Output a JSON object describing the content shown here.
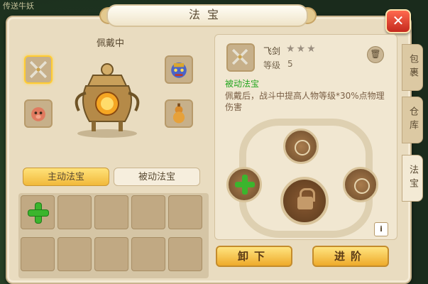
{
  "background": {
    "corner_text": "传送牛妖"
  },
  "window": {
    "title": "法宝",
    "close_label": "✕"
  },
  "left": {
    "wearing_label": "佩戴中",
    "tabs": [
      {
        "label": "主动法宝",
        "active": true
      },
      {
        "label": "被动法宝",
        "active": false
      }
    ],
    "grid": {
      "rows": 3,
      "cols": 5,
      "add_cell_index": 0
    }
  },
  "detail": {
    "name": "飞剑",
    "stars": "★★★",
    "level_label": "等级",
    "level_value": "5",
    "type_tag": "被动法宝",
    "description": "佩戴后，战斗中提高人物等级*30%点物理伤害",
    "trash_label": "🗑",
    "info_label": "i"
  },
  "actions": {
    "unequip": "卸下",
    "upgrade": "进阶"
  },
  "side_tabs": [
    {
      "label": "包裹",
      "active": false
    },
    {
      "label": "仓库",
      "active": false
    },
    {
      "label": "法宝",
      "active": true
    }
  ],
  "colors": {
    "accent_gold": "#f1b93a",
    "panel": "#e9dcc0",
    "green": "#23a51e",
    "close_red": "#c4291d"
  }
}
